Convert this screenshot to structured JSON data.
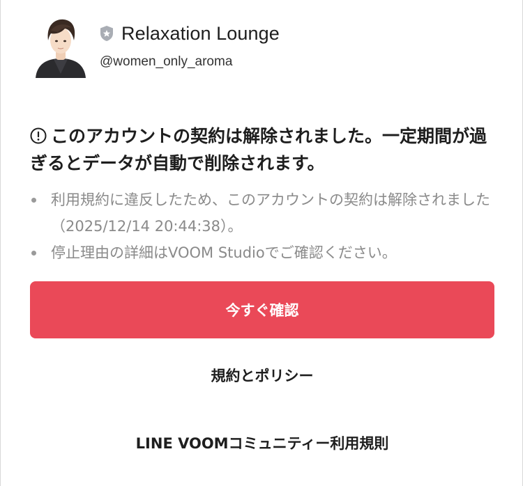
{
  "account": {
    "name": "Relaxation Lounge",
    "handle": "@women_only_aroma",
    "avatar_icon": "avatar-illustration",
    "badge_icon": "shield-star-icon"
  },
  "notice": {
    "icon": "alert-circle-icon",
    "title": "このアカウントの契約は解除されました。一定期間が過ぎるとデータが自動で削除されます。",
    "items": [
      "利用規約に違反したため、このアカウントの契約は解除されました（2025/12/14 20:44:38）。",
      "停止理由の詳細はVOOM Studioでご確認ください。"
    ]
  },
  "actions": {
    "confirm_label": "今すぐ確認",
    "policy_label": "規約とポリシー",
    "guidelines_label": "LINE VOOMコミュニティー利用規則"
  },
  "colors": {
    "accent": "#ea4958",
    "text": "#1e1e1e",
    "muted": "#8a8a8a",
    "badge": "#a9adb4"
  }
}
